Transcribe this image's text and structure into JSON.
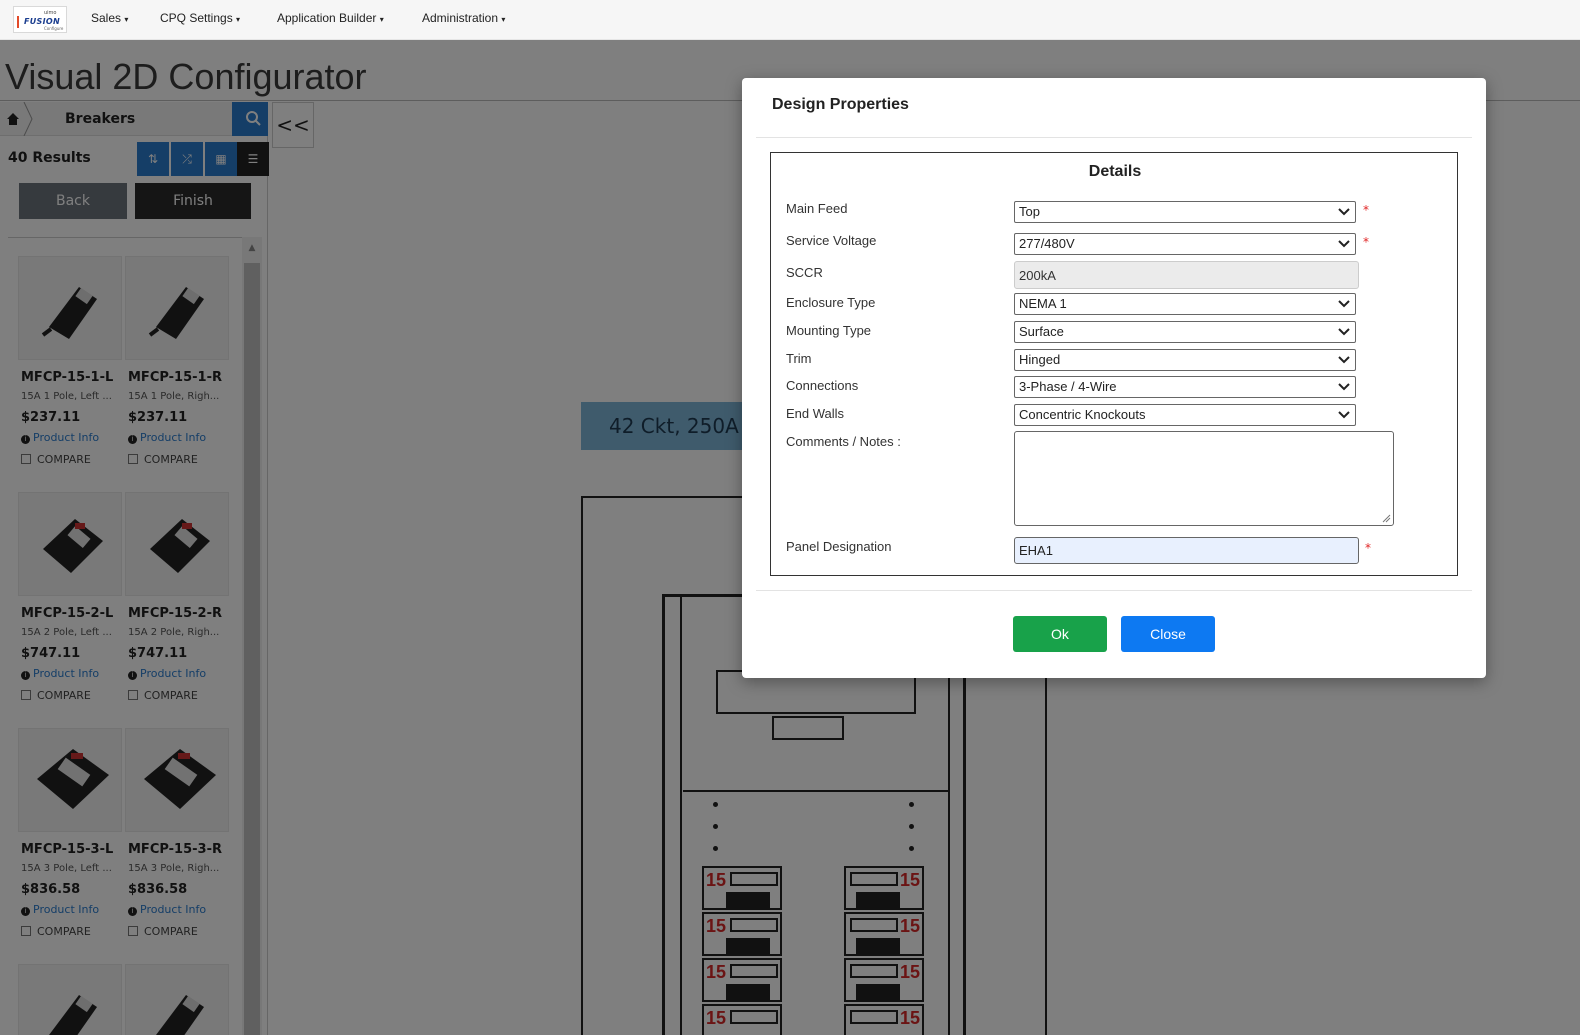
{
  "nav": {
    "logo": {
      "top": "uimo",
      "main": "FUSION",
      "sub": "Configure"
    },
    "items": [
      {
        "label": "Sales"
      },
      {
        "label": "CPQ Settings"
      },
      {
        "label": "Application Builder"
      },
      {
        "label": "Administration"
      }
    ]
  },
  "page": {
    "title": "Visual 2D Configurator"
  },
  "sidebar": {
    "breadcrumb": "Breakers",
    "results": "40 Results",
    "back_label": "Back",
    "finish_label": "Finish",
    "collapse_label": "<<",
    "products": [
      {
        "sku": "MFCP-15-1-L",
        "desc": "15A 1 Pole, Left ...",
        "price": "$237.11",
        "info": "Product Info",
        "compare": "COMPARE"
      },
      {
        "sku": "MFCP-15-1-R",
        "desc": "15A 1 Pole, Righ...",
        "price": "$237.11",
        "info": "Product Info",
        "compare": "COMPARE"
      },
      {
        "sku": "MFCP-15-2-L",
        "desc": "15A 2 Pole, Left ...",
        "price": "$747.11",
        "info": "Product Info",
        "compare": "COMPARE"
      },
      {
        "sku": "MFCP-15-2-R",
        "desc": "15A 2 Pole, Righ...",
        "price": "$747.11",
        "info": "Product Info",
        "compare": "COMPARE"
      },
      {
        "sku": "MFCP-15-3-L",
        "desc": "15A 3 Pole, Left ...",
        "price": "$836.58",
        "info": "Product Info",
        "compare": "COMPARE"
      },
      {
        "sku": "MFCP-15-3-R",
        "desc": "15A 3 Pole, Righ...",
        "price": "$836.58",
        "info": "Product Info",
        "compare": "COMPARE"
      }
    ]
  },
  "canvas": {
    "ckt_label": "42 Ckt, 250A",
    "breaker_rating": "15"
  },
  "modal": {
    "title": "Design Properties",
    "section_title": "Details",
    "fields": {
      "main_feed": {
        "label": "Main Feed",
        "value": "Top"
      },
      "service_voltage": {
        "label": "Service Voltage",
        "value": "277/480V"
      },
      "sccr": {
        "label": "SCCR",
        "value": "200kA"
      },
      "enclosure_type": {
        "label": "Enclosure Type",
        "value": "NEMA 1"
      },
      "mounting_type": {
        "label": "Mounting Type",
        "value": "Surface"
      },
      "trim": {
        "label": "Trim",
        "value": "Hinged"
      },
      "connections": {
        "label": "Connections",
        "value": "3-Phase / 4-Wire"
      },
      "end_walls": {
        "label": "End Walls",
        "value": "Concentric Knockouts"
      },
      "comments": {
        "label": "Comments / Notes :",
        "value": ""
      },
      "panel_designation": {
        "label": "Panel Designation",
        "value": "EHA1"
      }
    },
    "required_mark": "*",
    "ok_label": "Ok",
    "close_label": "Close"
  },
  "colors": {
    "accent": "#2a7ccf",
    "ok": "#18a24a",
    "close": "#0d79f2",
    "breaker_number": "#d62828"
  },
  "icons": [
    "home-icon",
    "search-icon",
    "sort-icon",
    "shuffle-icon",
    "grid-view-icon",
    "list-view-icon",
    "info-icon",
    "chevron-down-icon"
  ]
}
